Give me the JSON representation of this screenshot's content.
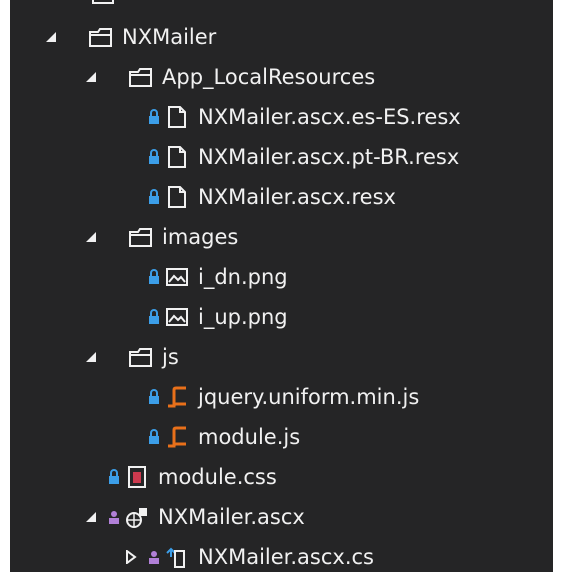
{
  "tree": {
    "items": [
      {
        "label": "NXMailer",
        "icon": "folder-icon",
        "expander": "expanded"
      },
      {
        "label": "App_LocalResources",
        "icon": "folder-icon",
        "expander": "expanded"
      },
      {
        "label": "NXMailer.ascx.es-ES.resx",
        "icon": "file-icon",
        "badge": "lock-icon"
      },
      {
        "label": "NXMailer.ascx.pt-BR.resx",
        "icon": "file-icon",
        "badge": "lock-icon"
      },
      {
        "label": "NXMailer.ascx.resx",
        "icon": "file-icon",
        "badge": "lock-icon"
      },
      {
        "label": "images",
        "icon": "folder-icon",
        "expander": "expanded"
      },
      {
        "label": "i_dn.png",
        "icon": "image-icon",
        "badge": "lock-icon"
      },
      {
        "label": "i_up.png",
        "icon": "image-icon",
        "badge": "lock-icon"
      },
      {
        "label": "js",
        "icon": "folder-icon",
        "expander": "expanded"
      },
      {
        "label": "jquery.uniform.min.js",
        "icon": "javascript-file-icon",
        "badge": "lock-icon"
      },
      {
        "label": "module.js",
        "icon": "javascript-file-icon",
        "badge": "lock-icon"
      },
      {
        "label": "module.css",
        "icon": "css-file-icon",
        "badge": "lock-icon"
      },
      {
        "label": "NXMailer.ascx",
        "icon": "web-user-control-icon",
        "badge": "user-lock-icon",
        "expander": "expanded"
      },
      {
        "label": "NXMailer.ascx.cs",
        "icon": "csharp-file-icon",
        "badge": "user-lock-icon",
        "expander": "collapsed"
      }
    ]
  },
  "colors": {
    "background": "#252526",
    "text": "#f1f1f1",
    "lock": "#3c9ee8",
    "js": "#e8701a",
    "css": "#cc3a4e",
    "user": "#b180d7"
  }
}
